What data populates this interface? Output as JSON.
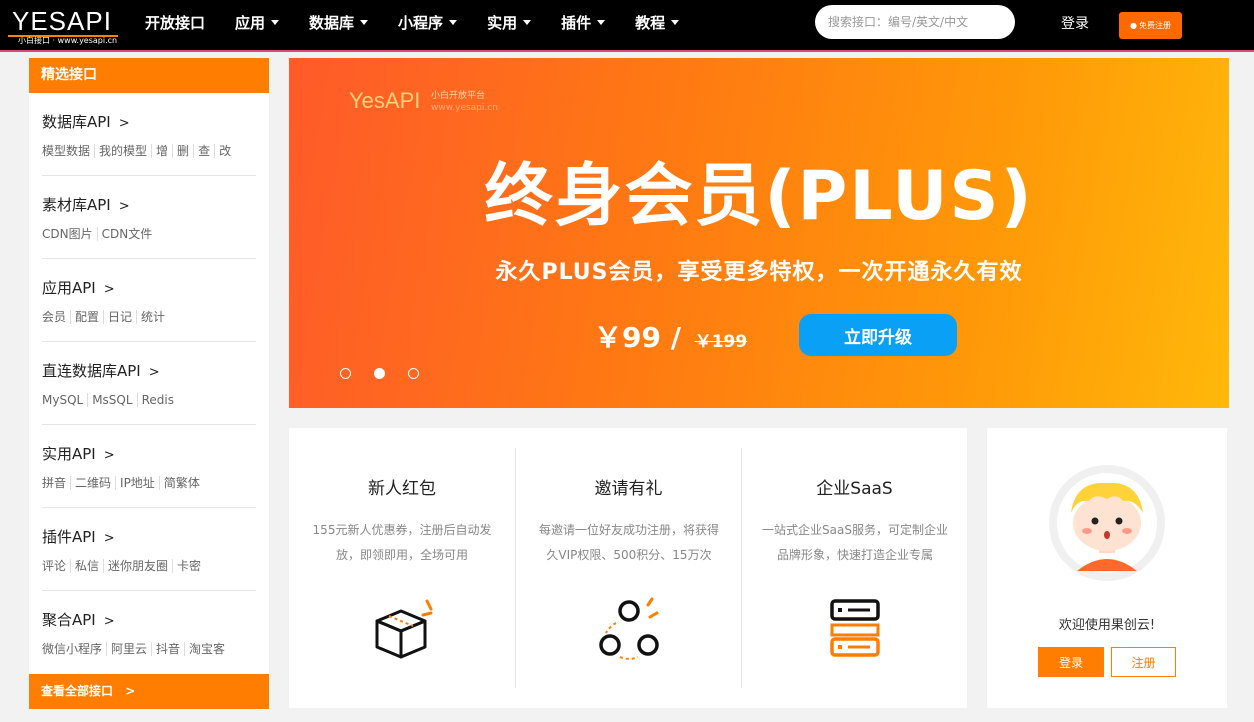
{
  "header": {
    "logo_text": "YESAPI",
    "logo_sub": "小白接口 · www.yesapi.cn",
    "nav": [
      {
        "label": "开放接口",
        "dropdown": false
      },
      {
        "label": "应用",
        "dropdown": true
      },
      {
        "label": "数据库",
        "dropdown": true
      },
      {
        "label": "小程序",
        "dropdown": true
      },
      {
        "label": "实用",
        "dropdown": true
      },
      {
        "label": "插件",
        "dropdown": true
      },
      {
        "label": "教程",
        "dropdown": true
      }
    ],
    "search_placeholder": "搜索接口：编号/英文/中文",
    "login_label": "登录",
    "register_label": "免费注册"
  },
  "sidebar": {
    "title": "精选接口",
    "categories": [
      {
        "title": "数据库API",
        "links": [
          "模型数据",
          "我的模型",
          "增",
          "删",
          "查",
          "改"
        ]
      },
      {
        "title": "素材库API",
        "links": [
          "CDN图片",
          "CDN文件"
        ]
      },
      {
        "title": "应用API",
        "links": [
          "会员",
          "配置",
          "日记",
          "统计"
        ]
      },
      {
        "title": "直连数据库API",
        "links": [
          "MySQL",
          "MsSQL",
          "Redis"
        ]
      },
      {
        "title": "实用API",
        "links": [
          "拼音",
          "二维码",
          "IP地址",
          "简繁体"
        ]
      },
      {
        "title": "插件API",
        "links": [
          "评论",
          "私信",
          "迷你朋友圈",
          "卡密"
        ]
      },
      {
        "title": "聚合API",
        "links": [
          "微信小程序",
          "阿里云",
          "抖音",
          "淘宝客"
        ]
      }
    ],
    "more_label": "查看全部接口"
  },
  "banner": {
    "logo": "YesAPI",
    "logo_sub1": "小白开放平台",
    "logo_sub2": "www.yesapi.cn",
    "title": "终身会员(PLUS)",
    "subtitle": "永久PLUS会员，享受更多特权，一次开通永久有效",
    "price": "￥99 /",
    "old_price": "￥199",
    "cta": "立即升级",
    "slides": 3,
    "active_slide": 2
  },
  "features": [
    {
      "title": "新人红包",
      "desc": "155元新人优惠券，注册后自动发放，即领即用，全场可用",
      "icon": "box-icon"
    },
    {
      "title": "邀请有礼",
      "desc": "每邀请一位好友成功注册，将获得久VIP权限、500积分、15万次",
      "icon": "invite-icon"
    },
    {
      "title": "企业SaaS",
      "desc": "一站式企业SaaS服务，可定制企业品牌形象，快速打造企业专属",
      "icon": "server-icon"
    }
  ],
  "login_card": {
    "welcome": "欢迎使用果创云!",
    "login": "登录",
    "register": "注册"
  },
  "colors": {
    "accent": "#ff7d00",
    "cta_blue": "#0aa0f5",
    "nav_bg": "#000000"
  }
}
